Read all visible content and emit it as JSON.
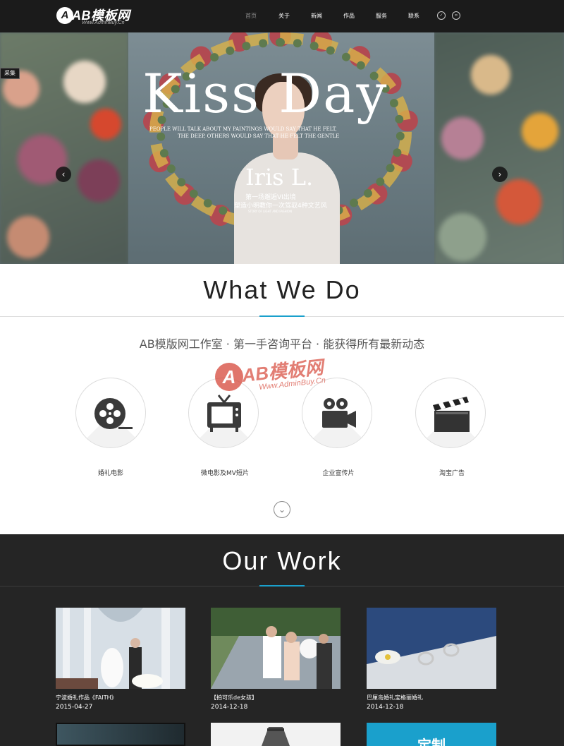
{
  "header": {
    "logo_mark": "A",
    "logo_text": "AB模板网",
    "logo_url": "Www.AdminBuy.Cn",
    "nav": [
      {
        "label": "首页",
        "active": true
      },
      {
        "label": "关于",
        "active": false
      },
      {
        "label": "新闻",
        "active": false
      },
      {
        "label": "作品",
        "active": false
      },
      {
        "label": "服务",
        "active": false
      },
      {
        "label": "联系",
        "active": false
      }
    ],
    "icons": [
      "weibo-icon",
      "wechat-icon"
    ]
  },
  "hero": {
    "badge": "采集",
    "title": "Kiss Day",
    "subtitle_line1": "PEOPLE WILL TALK ABOUT MY PAINTINGS WOULD SAY THAT HE FELT,",
    "subtitle_line2": "THE DEEP, OTHERS WOULD SAY THAT HE FELT THE GENTLE",
    "name": "Iris L.",
    "line1": "第一场邂逅VI出境",
    "line2": "塑造小明教你一次驾驭4种文艺风",
    "line3": "STORY OF LIGHT AND FASHION",
    "prev_icon": "chevron-left-icon",
    "next_icon": "chevron-right-icon"
  },
  "what_we_do": {
    "title": "What  We  Do",
    "subtitle": "AB模版网工作室 · 第一手咨询平台 · 能获得所有最新动态",
    "services": [
      {
        "label": "婚礼电影",
        "icon": "film-reel-icon"
      },
      {
        "label": "微电影及MV短片",
        "icon": "tv-icon"
      },
      {
        "label": "企业宣传片",
        "icon": "video-camera-icon"
      },
      {
        "label": "淘宝广告",
        "icon": "clapperboard-icon"
      }
    ],
    "watermark": {
      "mark": "A",
      "text": "AB模板网",
      "url": "Www.AdminBuy.Cn"
    },
    "scroll_icon": "chevron-down-icon"
  },
  "our_work": {
    "title": "Our  Work",
    "items": [
      {
        "caption": "宁波婚礼作品《FAITH》",
        "date": "2015-04-27"
      },
      {
        "caption": "【拍可乐de女孩】",
        "date": "2014-12-18"
      },
      {
        "caption": "巴厘岛婚礼宝格丽婚礼",
        "date": "2014-12-18"
      }
    ],
    "row2_label": "定制"
  }
}
